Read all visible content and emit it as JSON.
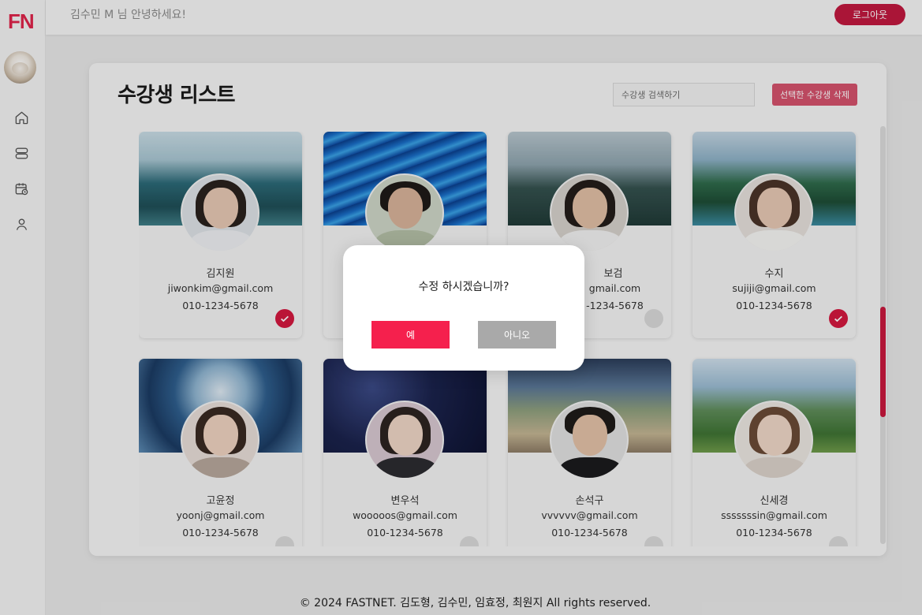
{
  "brand": {
    "logo": "FN",
    "accent": "#e0244a"
  },
  "header": {
    "greeting": "김수민 M 님 안녕하세요!",
    "logout_label": "로그아웃"
  },
  "sidebar": {
    "items": [
      {
        "name": "home",
        "icon": "home-icon"
      },
      {
        "name": "list",
        "icon": "list-icon"
      },
      {
        "name": "schedule",
        "icon": "calendar-clock-icon"
      },
      {
        "name": "profile",
        "icon": "user-icon"
      }
    ]
  },
  "main": {
    "title": "수강생 리스트",
    "search_placeholder": "수강생 검색하기",
    "delete_label": "선택한 수강생 삭제"
  },
  "students": [
    {
      "name": "김지원",
      "email": "jiwonkim@gmail.com",
      "phone": "010-1234-5678",
      "checked": true
    },
    {
      "name": "",
      "email": "",
      "phone": "",
      "checked": false
    },
    {
      "name": "보검",
      "email": "gmail.com",
      "phone": "-1234-5678",
      "checked": false
    },
    {
      "name": "수지",
      "email": "sujiji@gmail.com",
      "phone": "010-1234-5678",
      "checked": true
    },
    {
      "name": "고윤정",
      "email": "yoonj@gmail.com",
      "phone": "010-1234-5678",
      "checked": false
    },
    {
      "name": "변우석",
      "email": "wooooos@gmail.com",
      "phone": "010-1234-5678",
      "checked": false
    },
    {
      "name": "손석구",
      "email": "vvvvvv@gmail.com",
      "phone": "010-1234-5678",
      "checked": false
    },
    {
      "name": "신세경",
      "email": "sssssssin@gmail.com",
      "phone": "010-1234-5678",
      "checked": false
    }
  ],
  "modal": {
    "message": "수정 하시겠습니까?",
    "yes_label": "예",
    "no_label": "아니오"
  },
  "footer": {
    "text": "© 2024 FASTNET. 김도형, 김수민, 임효정, 최원지 All rights reserved."
  }
}
